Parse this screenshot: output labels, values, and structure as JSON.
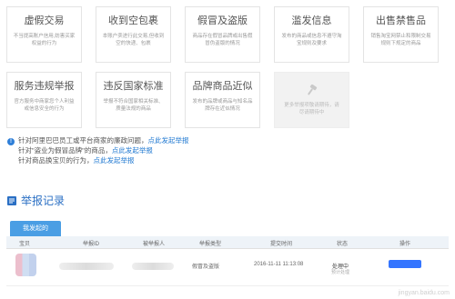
{
  "categories": [
    {
      "title": "虚假交易",
      "desc": "不当提高账户信用,妨害买家权益的行为"
    },
    {
      "title": "收到空包裹",
      "desc": "本账户卖进行此交易,但收到空的快递、包裹"
    },
    {
      "title": "假冒及盗版",
      "desc": "商品存在假冒品牌或出售假冒伪盗版的情况"
    },
    {
      "title": "滥发信息",
      "desc": "发布的商品或信息不遵守淘宝规则及要求"
    },
    {
      "title": "出售禁售品",
      "desc": "销售淘宝网禁止和限制交易规则下规定的商品"
    },
    {
      "title": "服务违规举报",
      "desc": "官方服务中商家您个人利益或信息安全的行为"
    },
    {
      "title": "违反国家标准",
      "desc": "举报不符合国家相关标准、质量法规的商品"
    },
    {
      "title": "品牌商品近似",
      "desc": "发布的品牌或商品与知名品牌存在近似情况"
    }
  ],
  "more_card": {
    "text": "更多举报项敬请期待，请尽请期待中",
    "icon": "gavel-icon"
  },
  "notes": [
    {
      "text": "针对阿里巴巴员工或平台商家的廉政问题，",
      "link": "点此发起举报"
    },
    {
      "text": "针对\"盗业为假冒品牌\"的商品，",
      "link": "点此发起举报"
    },
    {
      "text": "针对商品换宝贝的行为，",
      "link": "点此发起举报"
    }
  ],
  "records": {
    "title": "举报记录",
    "tab": "我发起的",
    "columns": [
      "宝贝",
      "举报ID",
      "被举报人",
      "举报类型",
      "提交时间",
      "状态",
      "操作"
    ],
    "rows": [
      {
        "type": "假冒及盗版",
        "time": "2016-11-11 11:13:08",
        "status": "处理中",
        "status_sub": "预计处理"
      }
    ]
  },
  "watermark": "jingyan.baidu.com",
  "colors": {
    "accent": "#4a9ee4",
    "link": "#1f78d1",
    "title": "#2a6fc4"
  }
}
